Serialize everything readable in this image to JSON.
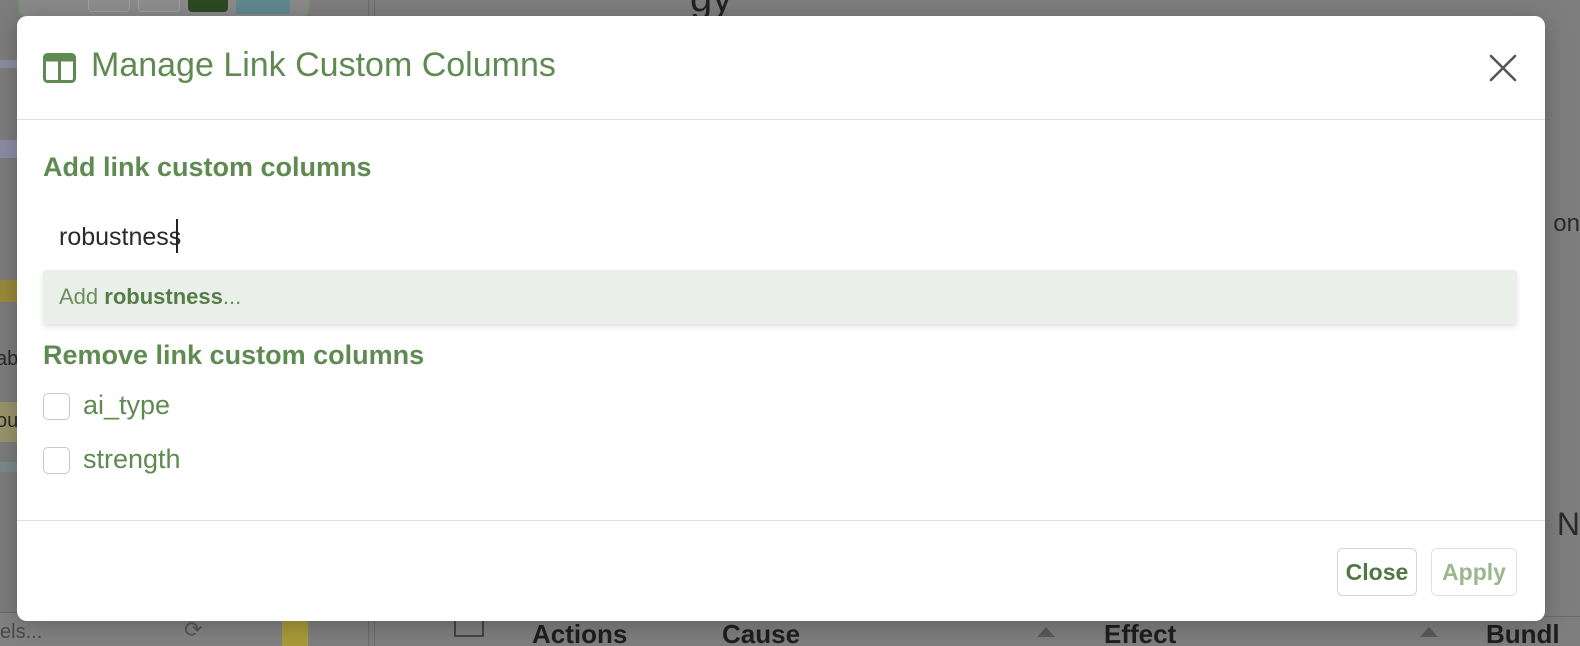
{
  "background": {
    "left_panel_text": "els...",
    "right_fragment_1": "on",
    "right_fragment_2": "N",
    "strip_texts": [
      "ab",
      "ou"
    ],
    "table_headers": [
      "Actions",
      "Cause",
      "Effect",
      "Bundl"
    ]
  },
  "modal": {
    "title": "Manage Link Custom Columns",
    "title_icon": "table-columns-icon",
    "close_icon": "close-icon",
    "add_section": {
      "title": "Add link custom columns",
      "input_value": "robustness",
      "suggestion": {
        "prefix": "Add ",
        "term": "robustness",
        "suffix": "..."
      }
    },
    "remove_section": {
      "title": "Remove link custom columns",
      "items": [
        {
          "label": "ai_type",
          "checked": false
        },
        {
          "label": "strength",
          "checked": false
        }
      ]
    },
    "footer": {
      "close_label": "Close",
      "apply_label": "Apply"
    }
  },
  "colors": {
    "accent": "#5f8a52",
    "suggestion_bg": "#ebefe9",
    "overlay": "#7e7e7e"
  }
}
